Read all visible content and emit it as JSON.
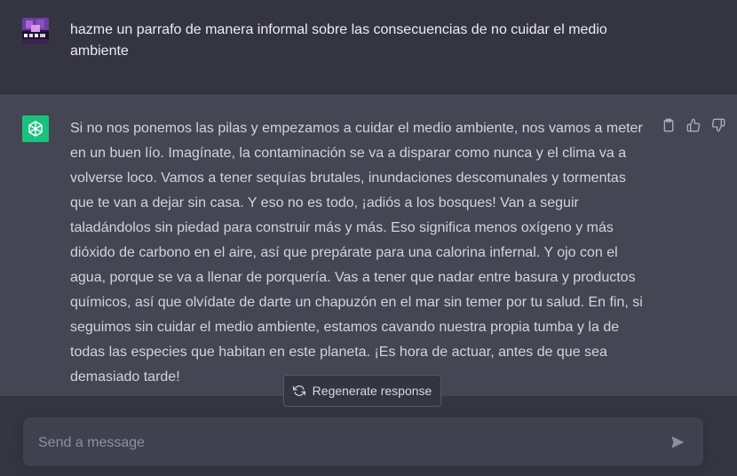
{
  "user_message": {
    "text": "hazme un parrafo de manera informal sobre las consecuencias de no cuidar el medio ambiente",
    "avatar_icon": "user-avatar-image"
  },
  "assistant_message": {
    "text": "Si no nos ponemos las pilas y empezamos a cuidar el medio ambiente, nos vamos a meter en un buen lío. Imagínate, la contaminación se va a disparar como nunca y el clima va a volverse loco. Vamos a tener sequías brutales, inundaciones descomunales y tormentas que te van a dejar sin casa. Y eso no es todo, ¡adiós a los bosques! Van a seguir taladándolos sin piedad para construir más y más. Eso significa menos oxígeno y más dióxido de carbono en el aire, así que prepárate para una calorina infernal. Y ojo con el agua, porque se va a llenar de porquería. Vas a tener que nadar entre basura y productos químicos, así que olvídate de darte un chapuzón en el mar sin temer por tu salud. En fin, si seguimos sin cuidar el medio ambiente, estamos cavando nuestra propia tumba y la de todas las especies que habitan en este planeta. ¡Es hora de actuar, antes de que sea demasiado tarde!",
    "avatar_icon": "openai-logo-icon",
    "actions": [
      "copy-icon",
      "thumbs-up-icon",
      "thumbs-down-icon"
    ]
  },
  "regenerate": {
    "label": "Regenerate response",
    "icon": "refresh-icon"
  },
  "composer": {
    "placeholder": "Send a message",
    "value": "",
    "send_icon": "send-icon"
  },
  "colors": {
    "background": "#343541",
    "assistant_background": "#444654",
    "input_background": "#40414f",
    "openai_green": "#19c37d"
  }
}
